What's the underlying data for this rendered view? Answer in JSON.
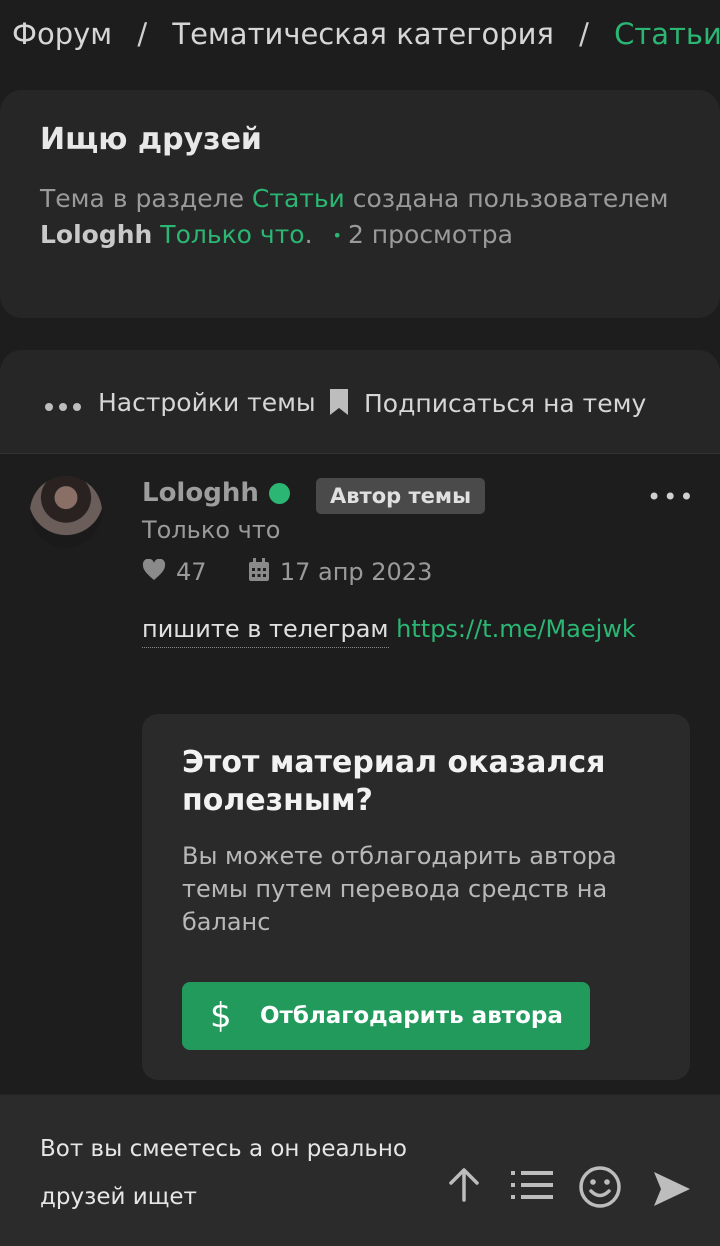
{
  "breadcrumb": {
    "items": [
      "Форум",
      "Тематическая категория",
      "Статьи"
    ],
    "separator": "/"
  },
  "thread": {
    "title": "Ищю друзей",
    "meta_prefix": "Тема в разделе",
    "meta_section": "Статьи",
    "meta_created_by": "создана пользователем",
    "meta_author": "Lologhh",
    "meta_time": "Только что",
    "meta_period": ".",
    "meta_dot": "•",
    "meta_views": "2 просмотра"
  },
  "actions": {
    "settings_label": "Настройки темы",
    "subscribe_label": "Подписаться на тему"
  },
  "post": {
    "author": "Lologhh",
    "badge": "Автор темы",
    "menu": "•••",
    "time": "Только что",
    "likes": "47",
    "date": "17 апр 2023",
    "body_text": "пишите в телеграм",
    "body_link": "https://t.me/Maejwk"
  },
  "thanks": {
    "title": "Этот материал оказался полезным?",
    "text": "Вы можете отблагодарить автора темы путем перевода средств на баланс",
    "button_label": "Отблагодарить автора",
    "button_icon": "$"
  },
  "reply": {
    "text": "Вот вы смеетесь а он реально друзей ищет"
  },
  "colors": {
    "accent": "#2bb673",
    "button": "#229a5c",
    "background": "#1d1d1d",
    "card": "#262626"
  },
  "icons": [
    "ellipsis-icon",
    "bookmark-icon",
    "heart-icon",
    "calendar-icon",
    "dollar-icon",
    "arrow-up-icon",
    "list-icon",
    "smile-icon",
    "send-icon"
  ]
}
